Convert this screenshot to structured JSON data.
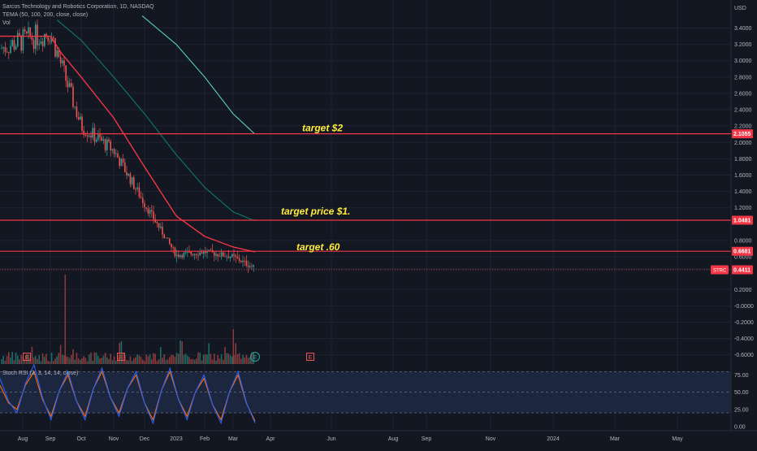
{
  "header": {
    "symbol_line": "Sarcos Technology and Robotics Corporation, 1D, NASDAQ",
    "indicator_line": "TEMA (50, 100, 200, close, close)",
    "volume_label": "Vol"
  },
  "price_axis": {
    "currency": "USD",
    "ticks": [
      "3.4000",
      "3.2000",
      "3.0000",
      "2.8000",
      "2.6000",
      "2.4000",
      "2.2000",
      "2.0000",
      "1.8000",
      "1.6000",
      "1.4000",
      "1.2000",
      "0.8000",
      "0.6000",
      "0.2000",
      "-0.0000",
      "-0.2000",
      "-0.4000",
      "-0.6000"
    ],
    "tick_values": [
      3.4,
      3.2,
      3.0,
      2.8,
      2.6,
      2.4,
      2.2,
      2.0,
      1.8,
      1.6,
      1.4,
      1.2,
      0.8,
      0.6,
      0.2,
      0.0,
      -0.2,
      -0.4,
      -0.6
    ]
  },
  "price_tags": [
    {
      "text": "2.1055",
      "value": 2.1055,
      "color": "#f23645"
    },
    {
      "text": "1.0481",
      "value": 1.0481,
      "color": "#f23645"
    },
    {
      "text": "0.6681",
      "value": 0.6681,
      "color": "#f23645"
    },
    {
      "text": "0.4411",
      "value": 0.4411,
      "color": "#f23645"
    }
  ],
  "symbol_tag": "STRC",
  "annotations": [
    {
      "text": "target $2",
      "color": "#ffeb3b"
    },
    {
      "text": "target price $1.",
      "color": "#ffeb3b"
    },
    {
      "text": "target .60",
      "color": "#ffeb3b"
    }
  ],
  "horizontal_lines": [
    {
      "value": 2.1055,
      "color": "#f23645"
    },
    {
      "value": 1.0481,
      "color": "#f23645"
    },
    {
      "value": 0.6681,
      "color": "#f23645"
    }
  ],
  "time_axis": {
    "labels": [
      "Aug",
      "Sep",
      "Oct",
      "Nov",
      "Dec",
      "2023",
      "Feb",
      "Mar",
      "Apr",
      "Jun",
      "Aug",
      "Sep",
      "Nov",
      "2024",
      "Mar",
      "May"
    ]
  },
  "earnings_marker": "E",
  "rsi": {
    "label": "Stoch RSI (3, 3, 14, 14, close)",
    "ticks": [
      "75.00",
      "50.00",
      "25.00",
      "0.00"
    ],
    "tick_values": [
      75,
      50,
      25,
      0
    ]
  },
  "colors": {
    "background": "#131722",
    "up_candle": "#26a69a",
    "down_candle": "#ef5350",
    "tema_fast": "#f23645",
    "tema_mid": "#0d7a6a",
    "tema_slow": "#5ad0c0",
    "rsi_k": "#2962ff",
    "rsi_d": "#ff6d00",
    "rsi_band": "#1e2a44"
  },
  "chart_data": {
    "type": "line",
    "title": "Sarcos Technology and Robotics Corporation, 1D, NASDAQ",
    "xlabel": "",
    "ylabel": "USD",
    "ylim": [
      -0.7,
      3.6
    ],
    "x": [
      "Aug",
      "Sep",
      "Oct",
      "Nov",
      "Dec",
      "2023",
      "Feb",
      "Mar"
    ],
    "series": [
      {
        "name": "Price",
        "values": [
          3.2,
          3.3,
          2.5,
          2.0,
          1.4,
          0.7,
          0.68,
          0.62
        ]
      },
      {
        "name": "TEMA 50",
        "values": [
          3.3,
          3.3,
          2.8,
          2.3,
          1.7,
          1.05,
          0.78,
          0.67
        ]
      },
      {
        "name": "TEMA 100",
        "values": [
          3.3,
          3.3,
          3.1,
          2.6,
          2.1,
          1.6,
          1.2,
          1.05
        ]
      },
      {
        "name": "TEMA 200",
        "values": [
          3.6,
          3.6,
          3.5,
          3.3,
          3.0,
          2.6,
          2.3,
          2.1
        ]
      }
    ],
    "stoch_rsi": {
      "k": [
        70,
        20,
        90,
        10,
        80,
        10,
        85,
        15,
        80,
        5,
        85,
        10,
        75,
        5,
        80,
        5
      ],
      "d": [
        60,
        25,
        80,
        15,
        75,
        15,
        80,
        20,
        75,
        10,
        80,
        15,
        70,
        10,
        75,
        8
      ]
    }
  }
}
